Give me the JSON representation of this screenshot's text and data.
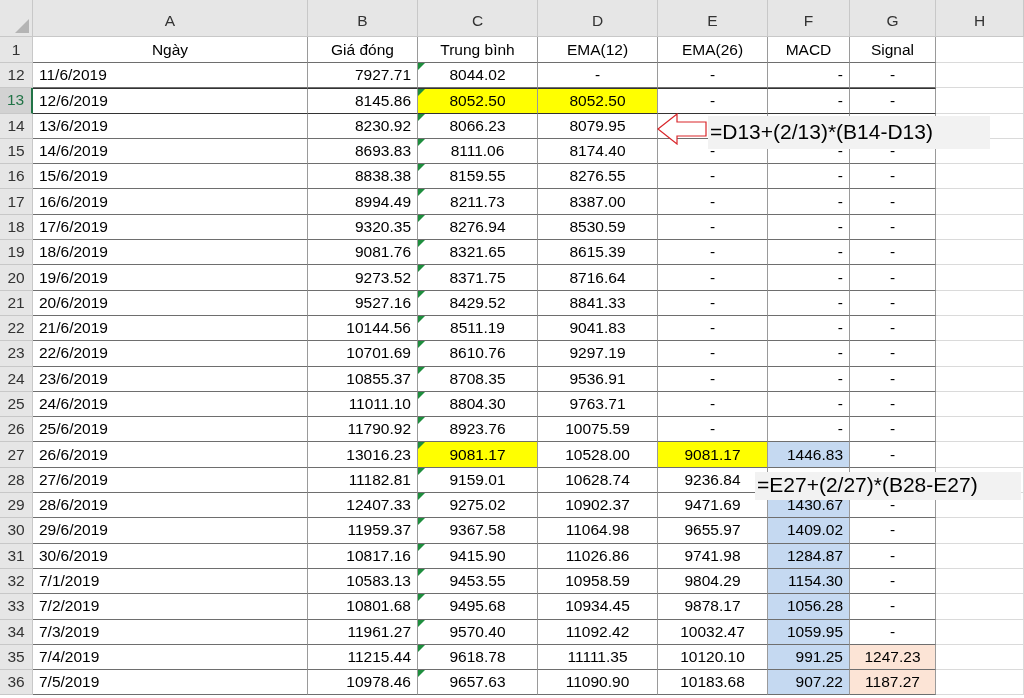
{
  "columns": [
    {
      "letter": "A",
      "heading": "Ngày"
    },
    {
      "letter": "B",
      "heading": "Giá đóng"
    },
    {
      "letter": "C",
      "heading": "Trung bình",
      "error_marker": true
    },
    {
      "letter": "D",
      "heading": "EMA(12)"
    },
    {
      "letter": "E",
      "heading": "EMA(26)"
    },
    {
      "letter": "F",
      "heading": "MACD"
    },
    {
      "letter": "G",
      "heading": "Signal"
    },
    {
      "letter": "H"
    }
  ],
  "header_row": "1",
  "rows": [
    {
      "row": "12",
      "selected": false,
      "cells": [
        "11/6/2019",
        "7927.71",
        "8044.02",
        "-",
        "-",
        "-",
        "-"
      ]
    },
    {
      "row": "13",
      "selected": true,
      "cells": [
        "12/6/2019",
        "8145.86",
        {
          "text": "8052.50",
          "color": "#ffff00"
        },
        {
          "text": "8052.50",
          "color": "#ffff00"
        },
        "-",
        "-",
        "-"
      ]
    },
    {
      "row": "14",
      "selected": false,
      "cells": [
        "13/6/2019",
        "8230.92",
        "8066.23",
        "8079.95",
        null,
        null,
        null
      ]
    },
    {
      "row": "15",
      "selected": false,
      "cells": [
        "14/6/2019",
        "8693.83",
        "8111.06",
        "8174.40",
        "-",
        "-",
        "-"
      ]
    },
    {
      "row": "16",
      "selected": false,
      "cells": [
        "15/6/2019",
        "8838.38",
        "8159.55",
        "8276.55",
        "-",
        "-",
        "-"
      ]
    },
    {
      "row": "17",
      "selected": false,
      "cells": [
        "16/6/2019",
        "8994.49",
        "8211.73",
        "8387.00",
        "-",
        "-",
        "-"
      ]
    },
    {
      "row": "18",
      "selected": false,
      "cells": [
        "17/6/2019",
        "9320.35",
        "8276.94",
        "8530.59",
        "-",
        "-",
        "-"
      ]
    },
    {
      "row": "19",
      "selected": false,
      "cells": [
        "18/6/2019",
        "9081.76",
        "8321.65",
        "8615.39",
        "-",
        "-",
        "-"
      ]
    },
    {
      "row": "20",
      "selected": false,
      "cells": [
        "19/6/2019",
        "9273.52",
        "8371.75",
        "8716.64",
        "-",
        "-",
        "-"
      ]
    },
    {
      "row": "21",
      "selected": false,
      "cells": [
        "20/6/2019",
        "9527.16",
        "8429.52",
        "8841.33",
        "-",
        "-",
        "-"
      ]
    },
    {
      "row": "22",
      "selected": false,
      "cells": [
        "21/6/2019",
        "10144.56",
        "8511.19",
        "9041.83",
        "-",
        "-",
        "-"
      ]
    },
    {
      "row": "23",
      "selected": false,
      "cells": [
        "22/6/2019",
        "10701.69",
        "8610.76",
        "9297.19",
        "-",
        "-",
        "-"
      ]
    },
    {
      "row": "24",
      "selected": false,
      "cells": [
        "23/6/2019",
        "10855.37",
        "8708.35",
        "9536.91",
        "-",
        "-",
        "-"
      ]
    },
    {
      "row": "25",
      "selected": false,
      "cells": [
        "24/6/2019",
        "11011.10",
        "8804.30",
        "9763.71",
        "-",
        "-",
        "-"
      ]
    },
    {
      "row": "26",
      "selected": false,
      "cells": [
        "25/6/2019",
        "11790.92",
        "8923.76",
        "10075.59",
        "-",
        "-",
        "-"
      ]
    },
    {
      "row": "27",
      "selected": false,
      "cells": [
        "26/6/2019",
        "13016.23",
        {
          "text": "9081.17",
          "color": "#ffff00"
        },
        "10528.00",
        {
          "text": "9081.17",
          "color": "#ffff00"
        },
        {
          "text": "1446.83",
          "color": "#c5d9f1"
        },
        "-"
      ]
    },
    {
      "row": "28",
      "selected": false,
      "cells": [
        "27/6/2019",
        "11182.81",
        "9159.01",
        "10628.74",
        "9236.84",
        null,
        null
      ]
    },
    {
      "row": "29",
      "selected": false,
      "cells": [
        "28/6/2019",
        "12407.33",
        "9275.02",
        "10902.37",
        "9471.69",
        {
          "text": "1430.67",
          "color": "#c5d9f1"
        },
        "-"
      ]
    },
    {
      "row": "30",
      "selected": false,
      "cells": [
        "29/6/2019",
        "11959.37",
        "9367.58",
        "11064.98",
        "9655.97",
        {
          "text": "1409.02",
          "color": "#c5d9f1"
        },
        "-"
      ]
    },
    {
      "row": "31",
      "selected": false,
      "cells": [
        "30/6/2019",
        "10817.16",
        "9415.90",
        "11026.86",
        "9741.98",
        {
          "text": "1284.87",
          "color": "#c5d9f1"
        },
        "-"
      ]
    },
    {
      "row": "32",
      "selected": false,
      "cells": [
        "7/1/2019",
        "10583.13",
        "9453.55",
        "10958.59",
        "9804.29",
        {
          "text": "1154.30",
          "color": "#c5d9f1"
        },
        "-"
      ]
    },
    {
      "row": "33",
      "selected": false,
      "cells": [
        "7/2/2019",
        "10801.68",
        "9495.68",
        "10934.45",
        "9878.17",
        {
          "text": "1056.28",
          "color": "#c5d9f1"
        },
        "-"
      ]
    },
    {
      "row": "34",
      "selected": false,
      "cells": [
        "7/3/2019",
        "11961.27",
        "9570.40",
        "11092.42",
        "10032.47",
        {
          "text": "1059.95",
          "color": "#c5d9f1"
        },
        "-"
      ]
    },
    {
      "row": "35",
      "selected": false,
      "cells": [
        "7/4/2019",
        "11215.44",
        "9618.78",
        "11111.35",
        "10120.10",
        {
          "text": "991.25",
          "color": "#c5d9f1"
        },
        {
          "text": "1247.23",
          "color": "#fce4d6"
        }
      ]
    },
    {
      "row": "36",
      "selected": false,
      "cells": [
        "7/5/2019",
        "10978.46",
        "9657.63",
        "11090.90",
        "10183.68",
        {
          "text": "907.22",
          "color": "#c5d9f1"
        },
        {
          "text": "1187.27",
          "color": "#fce4d6"
        }
      ]
    }
  ],
  "callouts": [
    {
      "text": "=D13+(2/13)*(B14-D13)",
      "arrow": true
    },
    {
      "text": "=E27+(2/27)*(B28-E27)",
      "arrow": false
    }
  ]
}
